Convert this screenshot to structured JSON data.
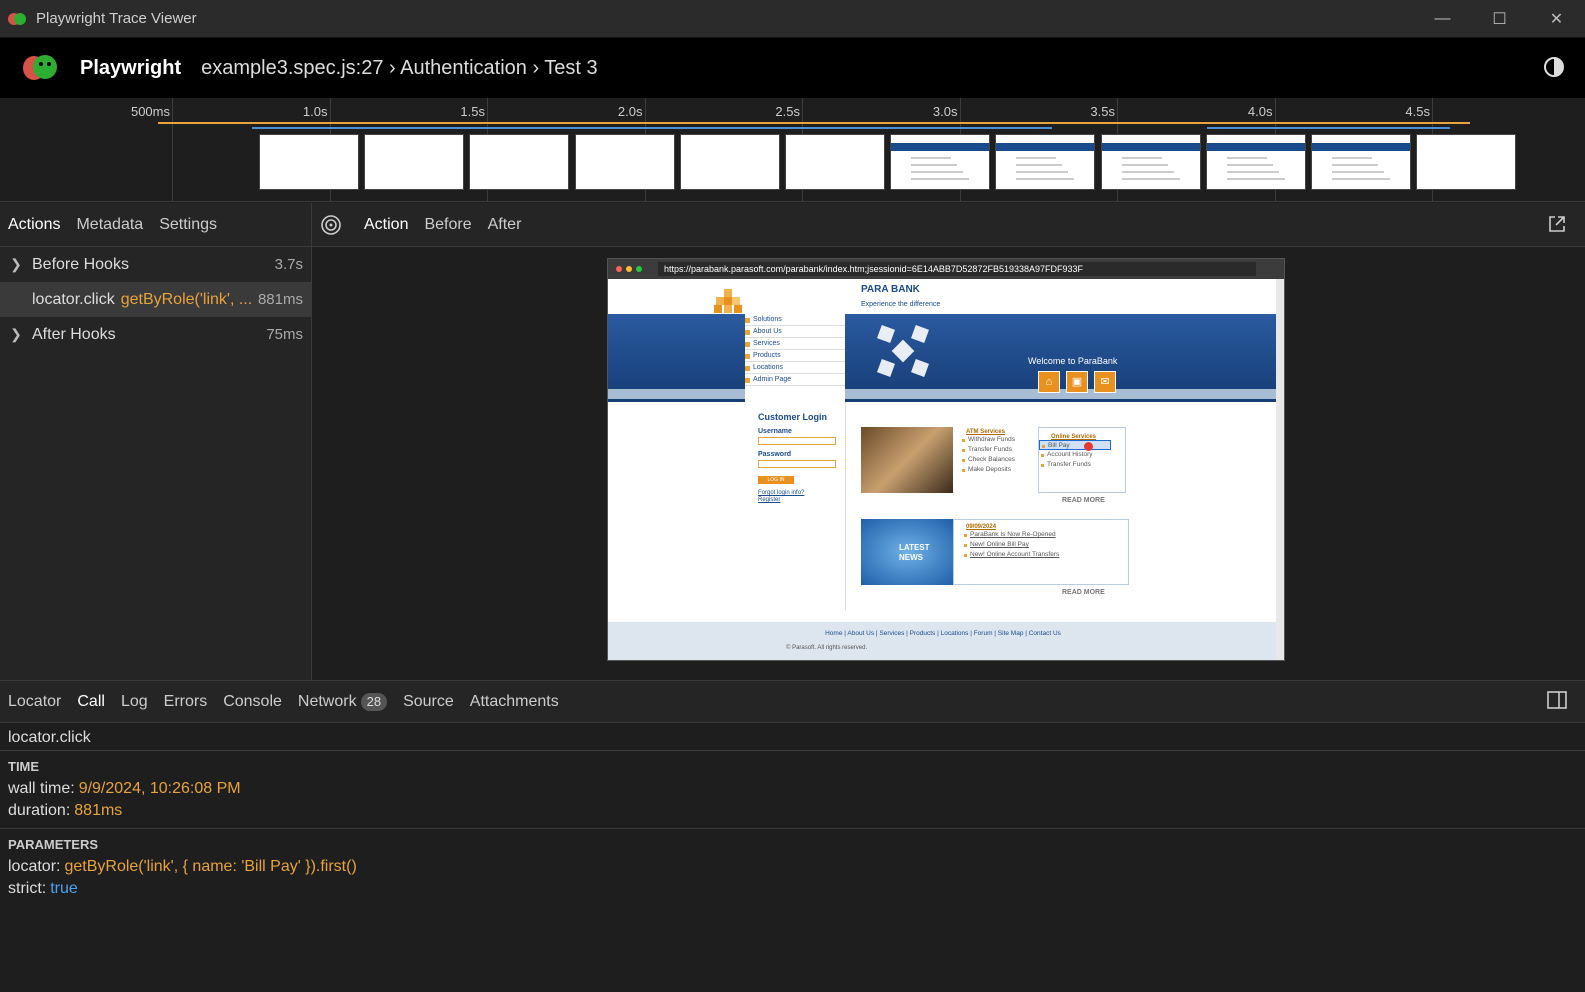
{
  "window": {
    "title": "Playwright Trace Viewer"
  },
  "header": {
    "brand": "Playwright",
    "breadcrumb": "example3.spec.js:27 › Authentication › Test 3"
  },
  "timeline": {
    "ticks": [
      "500ms",
      "1.0s",
      "1.5s",
      "2.0s",
      "2.5s",
      "3.0s",
      "3.5s",
      "4.0s",
      "4.5s"
    ]
  },
  "left_tabs": [
    "Actions",
    "Metadata",
    "Settings"
  ],
  "actions": [
    {
      "name": "Before Hooks",
      "selector": "",
      "duration": "3.7s",
      "expandable": true
    },
    {
      "name": "locator.click",
      "selector": "getByRole('link', ...",
      "duration": "881ms",
      "expandable": false,
      "selected": true
    },
    {
      "name": "After Hooks",
      "selector": "",
      "duration": "75ms",
      "expandable": true
    }
  ],
  "snapshot_tabs": [
    "Action",
    "Before",
    "After"
  ],
  "browser": {
    "url": "https://parabank.parasoft.com/parabank/index.htm;jsessionid=6E14ABB7D52872FB519338A97FDF933F",
    "logo": "PARA BANK",
    "tagline": "Experience the difference",
    "nav": [
      "Solutions",
      "About Us",
      "Services",
      "Products",
      "Locations",
      "Admin Page"
    ],
    "welcome": "Welcome to ParaBank",
    "login": {
      "heading": "Customer Login",
      "username": "Username",
      "password": "Password",
      "button": "LOG IN",
      "forgot": "Forgot login info?",
      "register": "Register"
    },
    "atm": {
      "heading": "ATM Services",
      "items": [
        "Withdraw Funds",
        "Transfer Funds",
        "Check Balances",
        "Make Deposits"
      ]
    },
    "online": {
      "heading": "Online Services",
      "items": [
        "Bill Pay",
        "Account History",
        "Transfer Funds"
      ]
    },
    "read_more": "READ MORE",
    "news": {
      "badge": "LATEST NEWS",
      "date": "09/09/2024",
      "items": [
        "ParaBank Is Now Re-Opened",
        "New! Online Bill Pay",
        "New! Online Account Transfers"
      ]
    },
    "footer_links": "Home | About Us | Services | Products | Locations | Forum | Site Map | Contact Us",
    "copyright": "© Parasoft. All rights reserved."
  },
  "bottom_tabs": {
    "locator": "Locator",
    "call": "Call",
    "log": "Log",
    "errors": "Errors",
    "console": "Console",
    "network": "Network",
    "network_count": "28",
    "source": "Source",
    "attachments": "Attachments"
  },
  "call": {
    "name": "locator.click",
    "time_heading": "TIME",
    "wall_time_label": "wall time:",
    "wall_time": "9/9/2024, 10:26:08 PM",
    "duration_label": "duration:",
    "duration": "881ms",
    "params_heading": "PARAMETERS",
    "locator_label": "locator:",
    "locator": "getByRole('link', { name: 'Bill Pay' }).first()",
    "strict_label": "strict:",
    "strict": "true"
  },
  "colors": {
    "accent": "#e8a33d",
    "blue": "#4aa3f0"
  }
}
